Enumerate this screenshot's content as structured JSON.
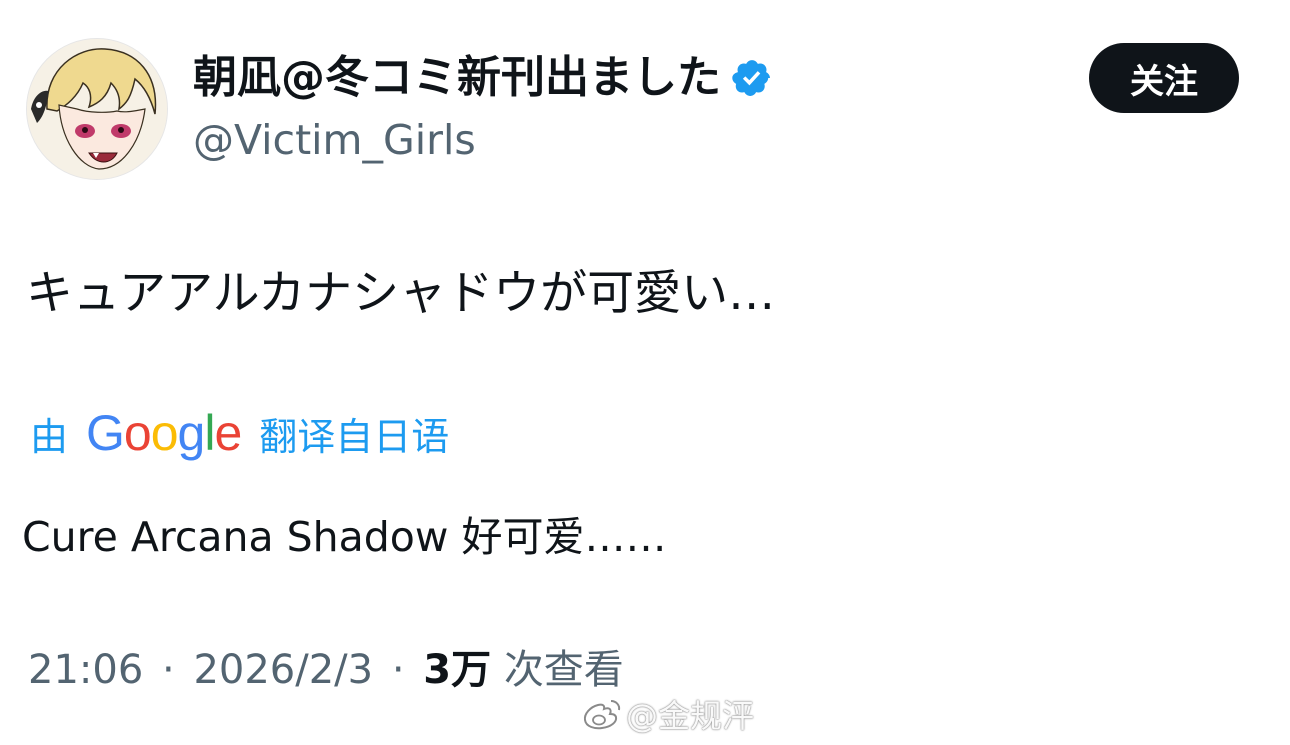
{
  "tweet": {
    "author": {
      "display_name": "朝凪@冬コミ新刊出ました",
      "handle": "@Victim_Girls",
      "verified": true,
      "avatar_icon": "anime-avatar-icon"
    },
    "follow_button_label": "关注",
    "text": "キュアアルカナシャドウが可愛い…",
    "translation": {
      "prefix": "由",
      "provider": "Google",
      "suffix": "翻译自日语",
      "translated_text": "Cure Arcana Shadow 好可爱……"
    },
    "meta": {
      "time": "21:06",
      "separator": "·",
      "date": "2026/2/3",
      "views_count": "3万",
      "views_label": "次查看"
    },
    "watermark": "@金规泙"
  },
  "colors": {
    "accent": "#1d9bf0",
    "text_primary": "#0f1419",
    "text_secondary": "#536471",
    "button_bg": "#0f1419"
  }
}
